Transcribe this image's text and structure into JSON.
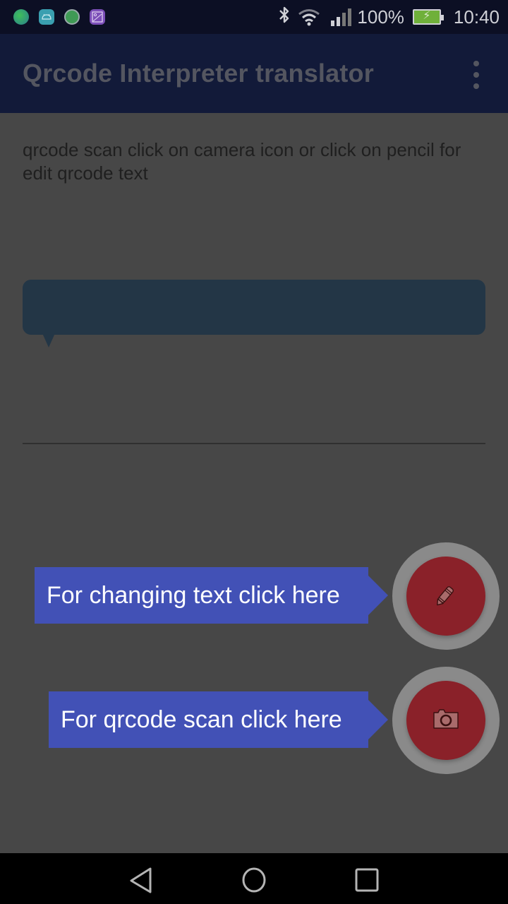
{
  "status_bar": {
    "notification_icons": [
      "app-globe-icon",
      "android-icon",
      "whatsapp-icon",
      "gallery-icon"
    ],
    "bluetooth_icon": "bluetooth-icon",
    "wifi_icon": "wifi-icon",
    "signal_icon": "signal-icon",
    "battery_percent": "100%",
    "battery_icon": "battery-charging-icon",
    "time": "10:40"
  },
  "app_bar": {
    "title": "Qrcode Interpreter translator",
    "menu_icon": "more-vert-icon"
  },
  "main": {
    "hint": "qrcode scan click on camera icon or click on pencil for edit qrcode text",
    "bubble_text": ""
  },
  "tutorial": {
    "edit_callout": "For changing text click here",
    "scan_callout": "For qrcode scan click here"
  },
  "fabs": {
    "edit_icon": "pencil-icon",
    "scan_icon": "camera-icon"
  },
  "nav_bar": {
    "back": "back-icon",
    "home": "home-icon",
    "recents": "recents-icon"
  },
  "colors": {
    "status_bar": "#0c0f24",
    "app_bar": "#121a39",
    "overlay_background": "#474747",
    "bubble": "#233646",
    "callout": "#4251b6",
    "fab": "#8a2129",
    "fab_halo": "#8a8a8a"
  }
}
